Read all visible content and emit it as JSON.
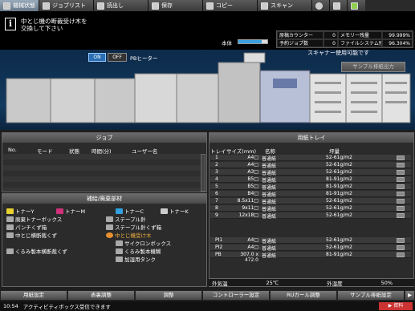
{
  "tabs": [
    {
      "label": "機械状態",
      "active": true
    },
    {
      "label": "ジョブリスト"
    },
    {
      "label": "読出し"
    },
    {
      "label": "保存"
    },
    {
      "label": "コピー"
    },
    {
      "label": "スキャン"
    }
  ],
  "message": {
    "line1": "中とじ機の断裁受け木を",
    "line2": "交換して下さい"
  },
  "counters": {
    "copy_counter_label": "原稿カウンター",
    "copy_counter_value": "0",
    "memory_label": "メモリー残量",
    "memory_value": "99.999%",
    "reserved_jobs_label": "予約ジョブ数",
    "reserved_jobs_value": "0",
    "filesys_label": "ファイルシステム残量",
    "filesys_value": "96.304%"
  },
  "toner": {
    "label": "本体",
    "level": 0.8
  },
  "scanner_msg": "スキャナー使用可能です",
  "sample_button": "サンプル排紙出力",
  "pb_heater": {
    "on": "ON",
    "off": "OFF",
    "label": "PBヒーター"
  },
  "job_panel": {
    "title": "ジョブ",
    "columns": [
      "No.",
      "モード",
      "状態",
      "時間(分)",
      "ユーザー名"
    ]
  },
  "supply_panel": {
    "title": "補給/廃棄部材",
    "items": [
      {
        "label": "トナーY",
        "color": "#e8d030"
      },
      {
        "label": "トナーM",
        "color": "#d0307a"
      },
      {
        "label": "トナーC",
        "color": "#30a0e0"
      },
      {
        "label": "トナーK",
        "color": "#cccccc"
      },
      {
        "label": "廃棄トナーボックス",
        "color": "#aaaaaa"
      },
      {
        "label": "ステープル針",
        "color": "#aaaaaa"
      },
      {
        "label": "パンチくず箱",
        "color": "#aaaaaa"
      },
      {
        "label": "ステープル針くず箱",
        "color": "#aaaaaa"
      },
      {
        "label": "中とじ横断裁くず",
        "color": "#aaaaaa"
      },
      {
        "label": "中とじ機受け木",
        "color": "#e89030",
        "warn": true
      },
      {
        "label": "サイクロンボックス",
        "color": "#aaaaaa"
      },
      {
        "label": "くるみ製本横断裁くず",
        "color": "#aaaaaa"
      },
      {
        "label": "くるみ製本機糊",
        "color": "#aaaaaa"
      },
      {
        "label": "加湿用タンク",
        "color": "#aaaaaa"
      }
    ]
  },
  "paper_panel": {
    "title": "用紙トレイ",
    "columns": [
      "トレイ",
      "サイズ(mm)",
      "名称",
      "坪量"
    ],
    "rows": [
      {
        "tray": "1",
        "size": "A4□",
        "name": "普通紙",
        "weight": "52-61g/m2"
      },
      {
        "tray": "2",
        "size": "A4□",
        "name": "普通紙",
        "weight": "52-61g/m2"
      },
      {
        "tray": "3",
        "size": "A3□",
        "name": "普通紙",
        "weight": "52-61g/m2"
      },
      {
        "tray": "4",
        "size": "B5□",
        "name": "普通紙",
        "weight": "81-91g/m2"
      },
      {
        "tray": "5",
        "size": "B5□",
        "name": "普通紙",
        "weight": "81-91g/m2"
      },
      {
        "tray": "6",
        "size": "B4□",
        "name": "普通紙",
        "weight": "81-91g/m2"
      },
      {
        "tray": "7",
        "size": "8.5x11□",
        "name": "普通紙",
        "weight": "52-61g/m2"
      },
      {
        "tray": "8",
        "size": "9x11□",
        "name": "普通紙",
        "weight": "52-61g/m2"
      },
      {
        "tray": "9",
        "size": "12x18□",
        "name": "普通紙",
        "weight": "52-61g/m2"
      },
      {
        "tray": "PI1",
        "size": "A4□",
        "name": "普通紙",
        "weight": "52-61g/m2"
      },
      {
        "tray": "PI2",
        "size": "A4□",
        "name": "普通紙",
        "weight": "52-61g/m2"
      },
      {
        "tray": "PB",
        "size": "307.0 x 472.0",
        "name": "普通紙",
        "weight": "81-91g/m2"
      }
    ],
    "outside_temp_label": "外気温",
    "outside_temp_value": "25℃",
    "outside_humid_label": "外湿度",
    "outside_humid_value": "50%"
  },
  "bottom_buttons": [
    "用紙設定",
    "表裏調整",
    "調整",
    "コントローラー設定",
    "RUカール調整",
    "サンプル排紙設定",
    "▶"
  ],
  "status": {
    "time": "10:54",
    "text": "アクティビティボックス受信できます",
    "reserve": "▶ 資料"
  }
}
